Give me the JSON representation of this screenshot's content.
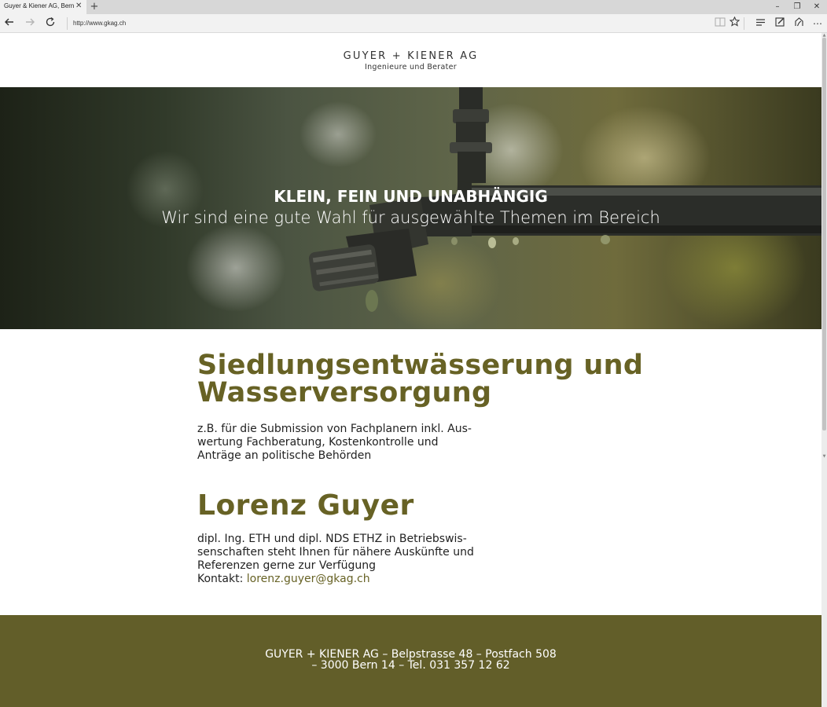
{
  "browser": {
    "tab_title": "Guyer & Kiener AG, Bern",
    "tab_close_icon": "close-icon",
    "new_tab_icon": "plus-icon",
    "url": "http://www.gkag.ch",
    "minimize_glyph": "–",
    "restore_glyph": "❐",
    "close_glyph": "✕",
    "more_glyph": "⋯"
  },
  "logo": {
    "main": "GUYER + KIENER AG",
    "sub": "Ingenieure und Berater"
  },
  "hero": {
    "title": "KLEIN, FEIN UND UNABHÄNGIG",
    "subtitle": "Wir sind eine gute Wahl für ausgewählte Themen im Bereich"
  },
  "service": {
    "heading_line1": "Siedlungsentwässerung und",
    "heading_line2": "Wasserversorgung",
    "text_line1": "z.B. für die Submission von Fachplanern inkl. Aus-",
    "text_line2": "wertung Fachberatung, Kostenkontrolle und",
    "text_line3": "Anträge an politische Behörden"
  },
  "person": {
    "name": "Lorenz Guyer",
    "text_line1": "dipl. Ing. ETH und dipl. NDS ETHZ in Betriebswis-",
    "text_line2": "senschaften steht Ihnen für nähere Auskünfte und",
    "text_line3": "Referenzen gerne zur Verfügung",
    "contact_label": "Kontakt: ",
    "email": "lorenz.guyer@gkag.ch"
  },
  "footer": {
    "line1": "GUYER + KIENER AG – Belpstrasse 48 – Postfach 508",
    "line2": "– 3000 Bern 14 – Tel. 031 357 12 62"
  },
  "colors": {
    "accent": "#676225",
    "footer_bg": "#625e29"
  }
}
